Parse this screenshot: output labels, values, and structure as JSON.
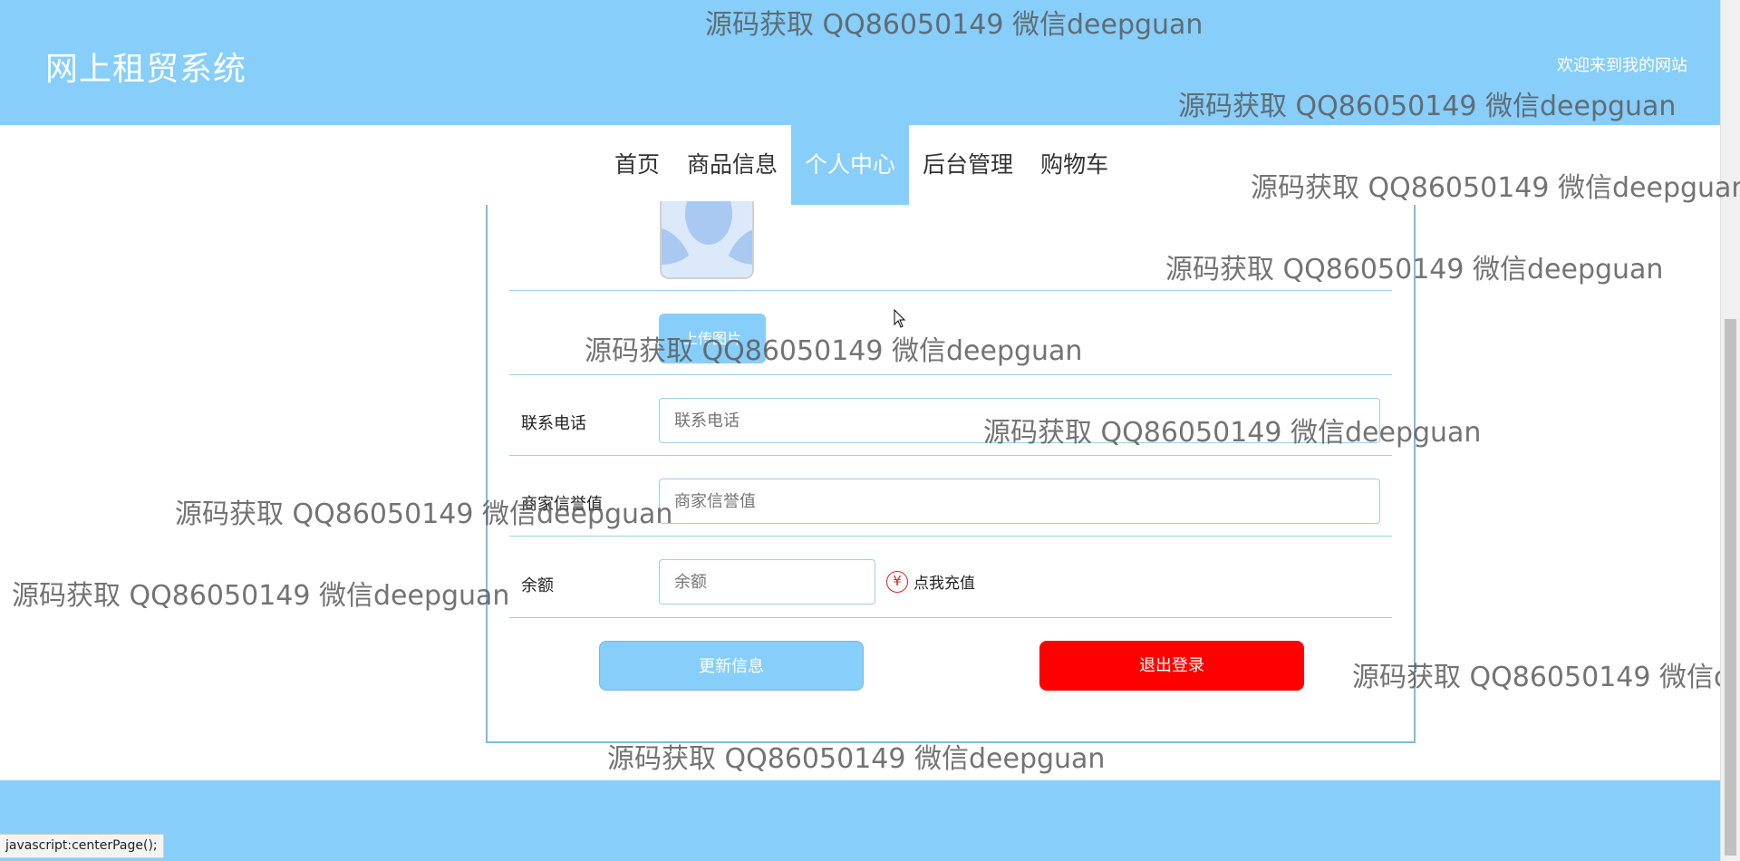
{
  "header": {
    "site_title": "网上租贸系统",
    "welcome": "欢迎来到我的网站"
  },
  "nav": {
    "items": [
      {
        "label": "首页"
      },
      {
        "label": "商品信息"
      },
      {
        "label": "个人中心"
      },
      {
        "label": "后台管理"
      },
      {
        "label": "购物车"
      }
    ],
    "active_index": 2
  },
  "profile": {
    "upload_label": "上传图片",
    "phone": {
      "label": "联系电话",
      "placeholder": "联系电话"
    },
    "credit": {
      "label": "商家信誉值",
      "placeholder": "商家信誉值"
    },
    "balance": {
      "label": "余额",
      "placeholder": "余额"
    },
    "recharge_label": "点我充值",
    "recharge_icon": "yen-circle-icon",
    "update_label": "更新信息",
    "logout_label": "退出登录"
  },
  "status_bar": {
    "text": "javascript:centerPage();"
  },
  "watermark": {
    "text": "源码获取 QQ86050149 微信deepguan"
  },
  "colors": {
    "primary": "#87cefa",
    "danger": "#ff0000",
    "border": "#9fd0e2"
  }
}
